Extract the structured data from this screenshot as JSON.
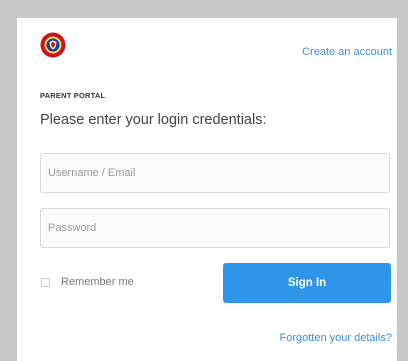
{
  "header": {
    "logo_icon": "school-crest-icon",
    "create_account_label": "Create an account"
  },
  "form": {
    "portal_label": "PARENT PORTAL",
    "heading": "Please enter your login credentials:",
    "username": {
      "value": "",
      "placeholder": "Username / Email"
    },
    "password": {
      "value": "",
      "placeholder": "Password"
    },
    "remember_me": {
      "label": "Remember me",
      "checked": false
    },
    "signin_label": "Sign In",
    "forgot_label": "Forgotten your details?"
  },
  "colors": {
    "accent": "#2e95e8",
    "link": "#3a8fd9",
    "page_background": "#c8c8c8",
    "logo_red": "#c8161d",
    "logo_blue": "#1c3f8f"
  }
}
